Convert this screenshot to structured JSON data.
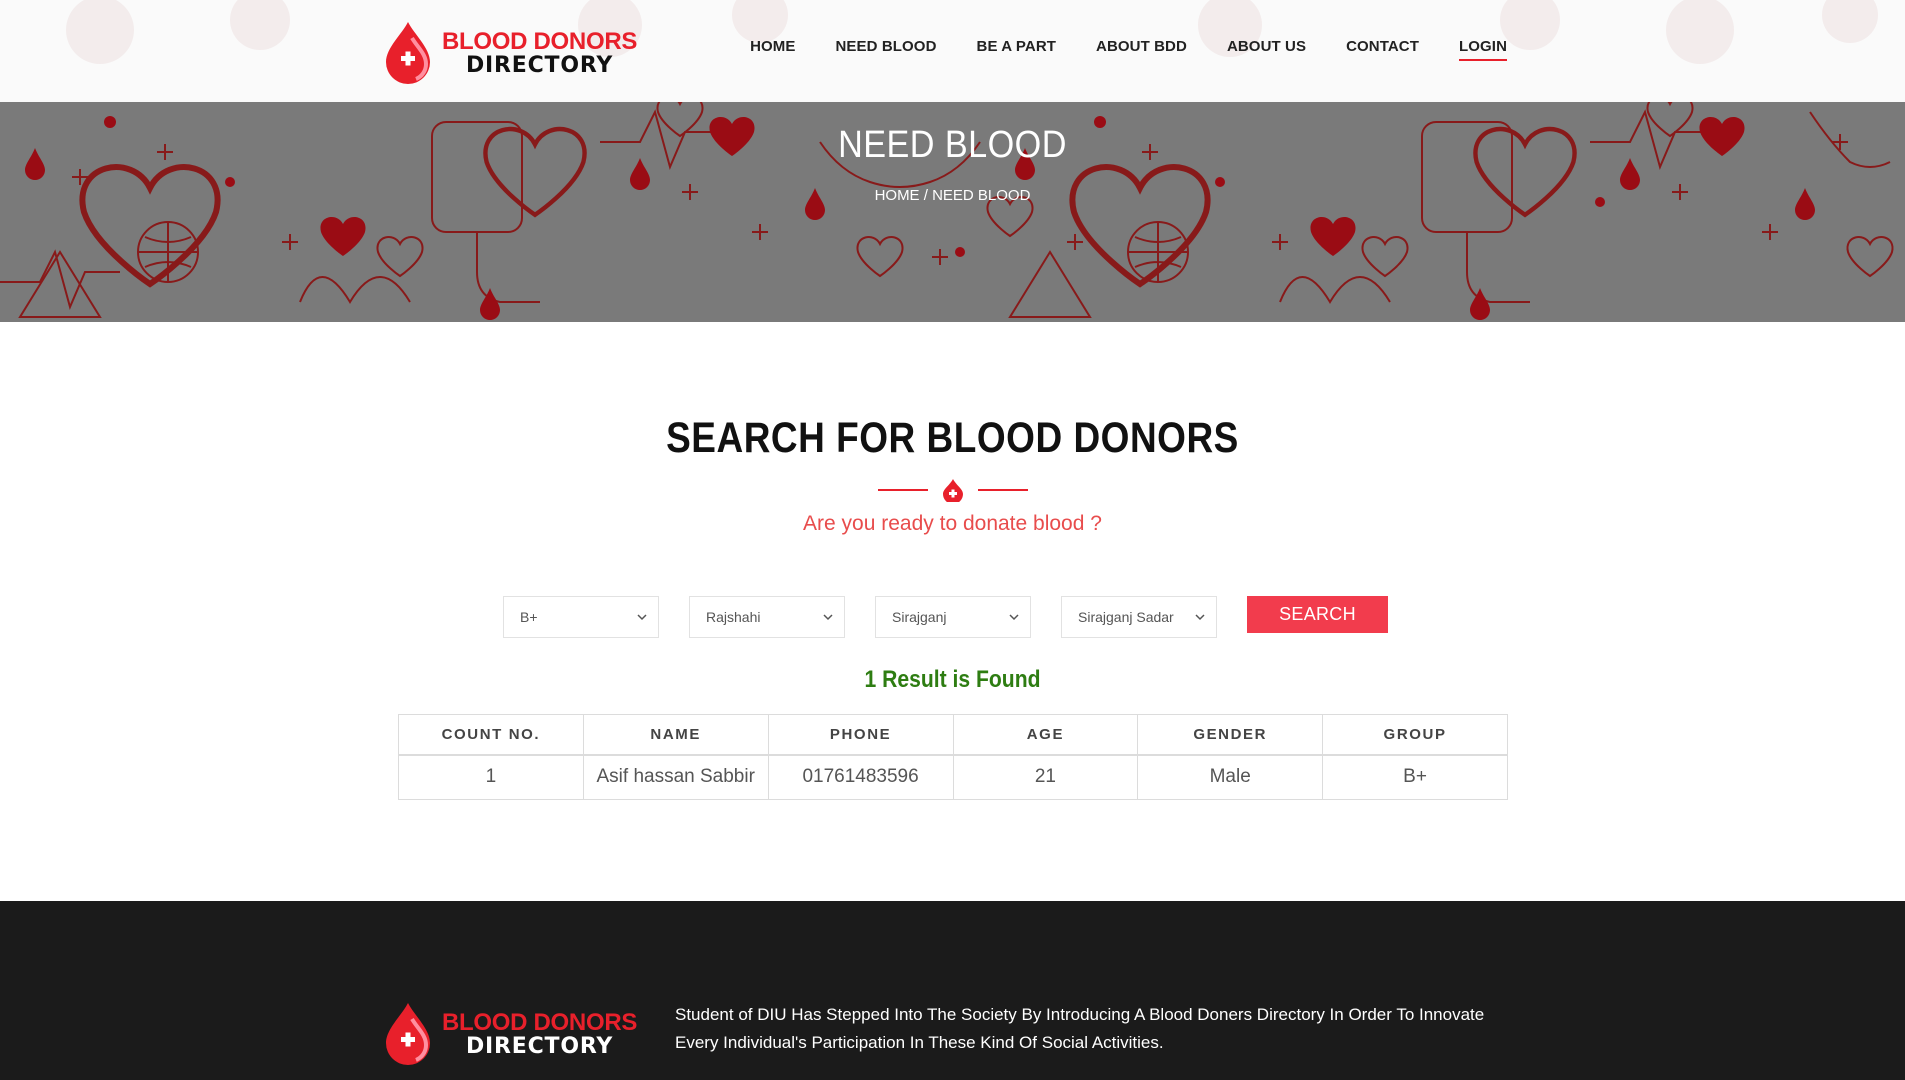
{
  "colors": {
    "accent": "#e8202b",
    "button": "#f23c4d",
    "result": "#2e7d12",
    "footer": "#1b1b1b"
  },
  "brand": {
    "line1": "BLOOD DONORS",
    "line2": "DIRECTORY"
  },
  "nav": {
    "items": [
      {
        "label": "HOME"
      },
      {
        "label": "NEED BLOOD"
      },
      {
        "label": "BE A PART"
      },
      {
        "label": "ABOUT BDD"
      },
      {
        "label": "ABOUT US"
      },
      {
        "label": "CONTACT"
      },
      {
        "label": "LOGIN"
      }
    ]
  },
  "hero": {
    "title": "NEED BLOOD",
    "breadcrumb_home": "HOME",
    "breadcrumb_sep": " / ",
    "breadcrumb_current": "NEED BLOOD"
  },
  "search": {
    "title": "SEARCH FOR BLOOD DONORS",
    "subtitle": "Are you ready to donate blood ?",
    "blood_group": "B+",
    "division": "Rajshahi",
    "district": "Sirajganj",
    "upazila": "Sirajganj Sadar",
    "button_label": "SEARCH"
  },
  "result_text": "1 Result is Found",
  "table": {
    "headers": [
      "COUNT NO.",
      "NAME",
      "PHONE",
      "AGE",
      "GENDER",
      "GROUP"
    ],
    "rows": [
      [
        "1",
        "Asif hassan Sabbir",
        "01761483596",
        "21",
        "Male",
        "B+"
      ]
    ]
  },
  "footer": {
    "text": "Student of DIU Has Stepped Into The Society By Introducing A Blood Doners Directory In Order To Innovate Every Individual's Participation In These Kind Of Social Activities."
  }
}
